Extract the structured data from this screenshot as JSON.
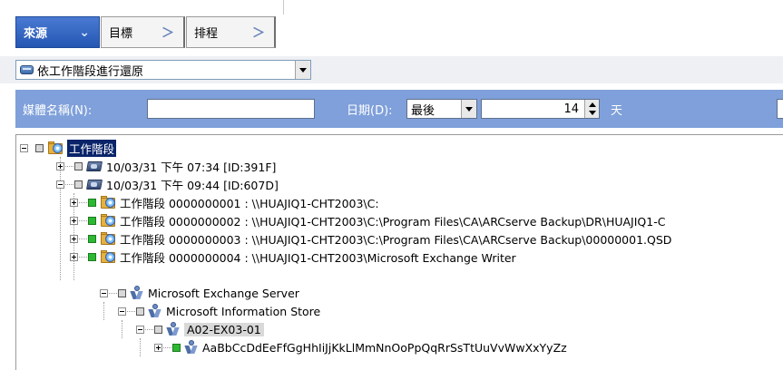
{
  "tabs": [
    {
      "label": "來源",
      "chevron": "⌄",
      "active": true
    },
    {
      "label": "目標",
      "chevron": "＞",
      "active": false
    },
    {
      "label": "排程",
      "chevron": "＞",
      "active": false
    }
  ],
  "restore_method": {
    "icon": "disk-icon",
    "value": "依工作階段進行還原"
  },
  "filter": {
    "media_label": "媒體名稱(N):",
    "media_value": "",
    "date_label": "日期(D):",
    "date_value": "最後",
    "days_value": "14",
    "days_unit": "天"
  },
  "tree": {
    "root": {
      "label": "工作階段",
      "icon": "session-folder-icon"
    },
    "nodes": [
      {
        "label": "10/03/31 下午 07:34 [ID:391F]"
      },
      {
        "label": "10/03/31 下午 09:44 [ID:607D]"
      },
      {
        "label": "工作階段 0000000001 : \\\\HUAJIQ1-CHT2003\\C:"
      },
      {
        "label": "工作階段 0000000002 : \\\\HUAJIQ1-CHT2003\\C:\\Program Files\\CA\\ARCserve Backup\\DR\\HUAJIQ1-C"
      },
      {
        "label": "工作階段 0000000003 : \\\\HUAJIQ1-CHT2003\\C:\\Program Files\\CA\\ARCserve Backup\\00000001.QSD"
      },
      {
        "label": "工作階段 0000000004 : \\\\HUAJIQ1-CHT2003\\Microsoft Exchange Writer"
      },
      {
        "label": "Microsoft Exchange Server"
      },
      {
        "label": "Microsoft Information Store"
      },
      {
        "label": "A02-EX03-01"
      },
      {
        "label": "AaBbCcDdEeFfGgHhIiJjKkLlMmNnOoPpQqRrSsTtUuVvWwXxYyZz"
      }
    ]
  },
  "colors": {
    "accent": "#2457b3",
    "filter_bar": "#7fa0da",
    "selection": "#0a246a",
    "checked": "#2db832"
  }
}
